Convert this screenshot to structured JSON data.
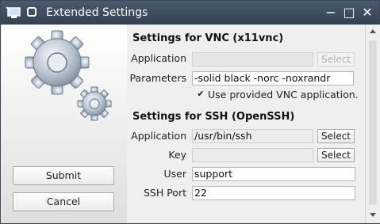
{
  "window": {
    "title": "Extended Settings",
    "controls": {
      "minimize": "−",
      "maximize": "□",
      "close": "✕"
    }
  },
  "left": {
    "submit_label": "Submit",
    "cancel_label": "Cancel"
  },
  "vnc": {
    "heading": "Settings for VNC (x11vnc)",
    "application_label": "Application",
    "application_value": "",
    "select_label": "Select",
    "parameters_label": "Parameters",
    "parameters_value": "-solid black -norc -noxrandr",
    "use_provided_label": "Use provided VNC application.",
    "use_provided_checked": true
  },
  "ssh": {
    "heading": "Settings for SSH (OpenSSH)",
    "application_label": "Application",
    "application_value": "/usr/bin/ssh",
    "application_select_label": "Select",
    "key_label": "Key",
    "key_value": "",
    "key_select_label": "Select",
    "user_label": "User",
    "user_value": "support",
    "port_label": "SSH Port",
    "port_value": "22"
  },
  "colors": {
    "titlebar": "#3c4a5c",
    "background": "#efefef"
  }
}
